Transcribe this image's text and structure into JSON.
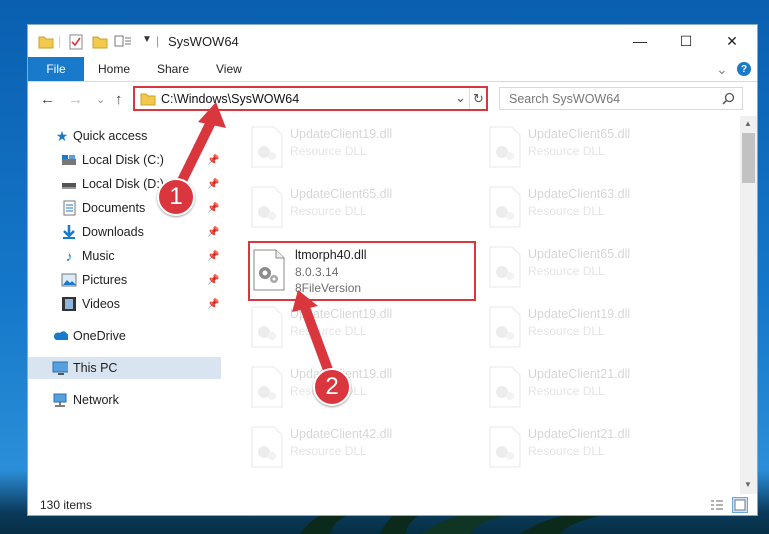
{
  "window": {
    "title": "SysWOW64"
  },
  "window_controls": {
    "minimize": "—",
    "maximize": "☐",
    "close": "✕"
  },
  "ribbon": {
    "file": "File",
    "tabs": [
      "Home",
      "Share",
      "View"
    ],
    "expand": "⌄",
    "help": "?"
  },
  "nav": {
    "back": "←",
    "forward": "→",
    "recent": "⌄",
    "up": "↑"
  },
  "address": {
    "path": "C:\\Windows\\SysWOW64",
    "dropdown": "⌄",
    "refresh": "↻"
  },
  "search": {
    "placeholder": "Search SysWOW64"
  },
  "sidebar": {
    "quick_access": "Quick access",
    "items": [
      {
        "label": "Local Disk (C:)",
        "pinned": true
      },
      {
        "label": "Local Disk (D:)",
        "pinned": true
      },
      {
        "label": "Documents",
        "pinned": true
      },
      {
        "label": "Downloads",
        "pinned": true
      },
      {
        "label": "Music",
        "pinned": true
      },
      {
        "label": "Pictures",
        "pinned": true
      },
      {
        "label": "Videos",
        "pinned": true
      }
    ],
    "onedrive": "OneDrive",
    "this_pc": "This PC",
    "network": "Network"
  },
  "files": {
    "left": [
      {
        "name": "UpdateClient19.dll",
        "sub": "Resource DLL"
      },
      {
        "name": "UpdateClient65.dll",
        "sub": "Resource DLL"
      },
      {
        "name": "ltmorph40.dll",
        "sub": "8.0.3.14",
        "sub2": "8FileVersion"
      },
      {
        "name": "UpdateClient19.dll",
        "sub": "Resource DLL"
      },
      {
        "name": "UpdateClient19.dll",
        "sub": "Resource DLL"
      },
      {
        "name": "UpdateClient42.dll",
        "sub": "Resource DLL"
      }
    ],
    "right": [
      {
        "name": "UpdateClient65.dll",
        "sub": "Resource DLL"
      },
      {
        "name": "UpdateClient63.dll",
        "sub": "Resource DLL"
      },
      {
        "name": "UpdateClient65.dll",
        "sub": "Resource DLL"
      },
      {
        "name": "UpdateClient19.dll",
        "sub": "Resource DLL"
      },
      {
        "name": "UpdateClient21.dll",
        "sub": "Resource DLL"
      },
      {
        "name": "UpdateClient21.dll",
        "sub": "Resource DLL"
      }
    ]
  },
  "status": {
    "count": "130 items"
  },
  "callouts": {
    "one": "1",
    "two": "2"
  },
  "colors": {
    "accent": "#1979ca",
    "highlight": "#d9363e",
    "selected_nav": "#d9e4f1"
  }
}
